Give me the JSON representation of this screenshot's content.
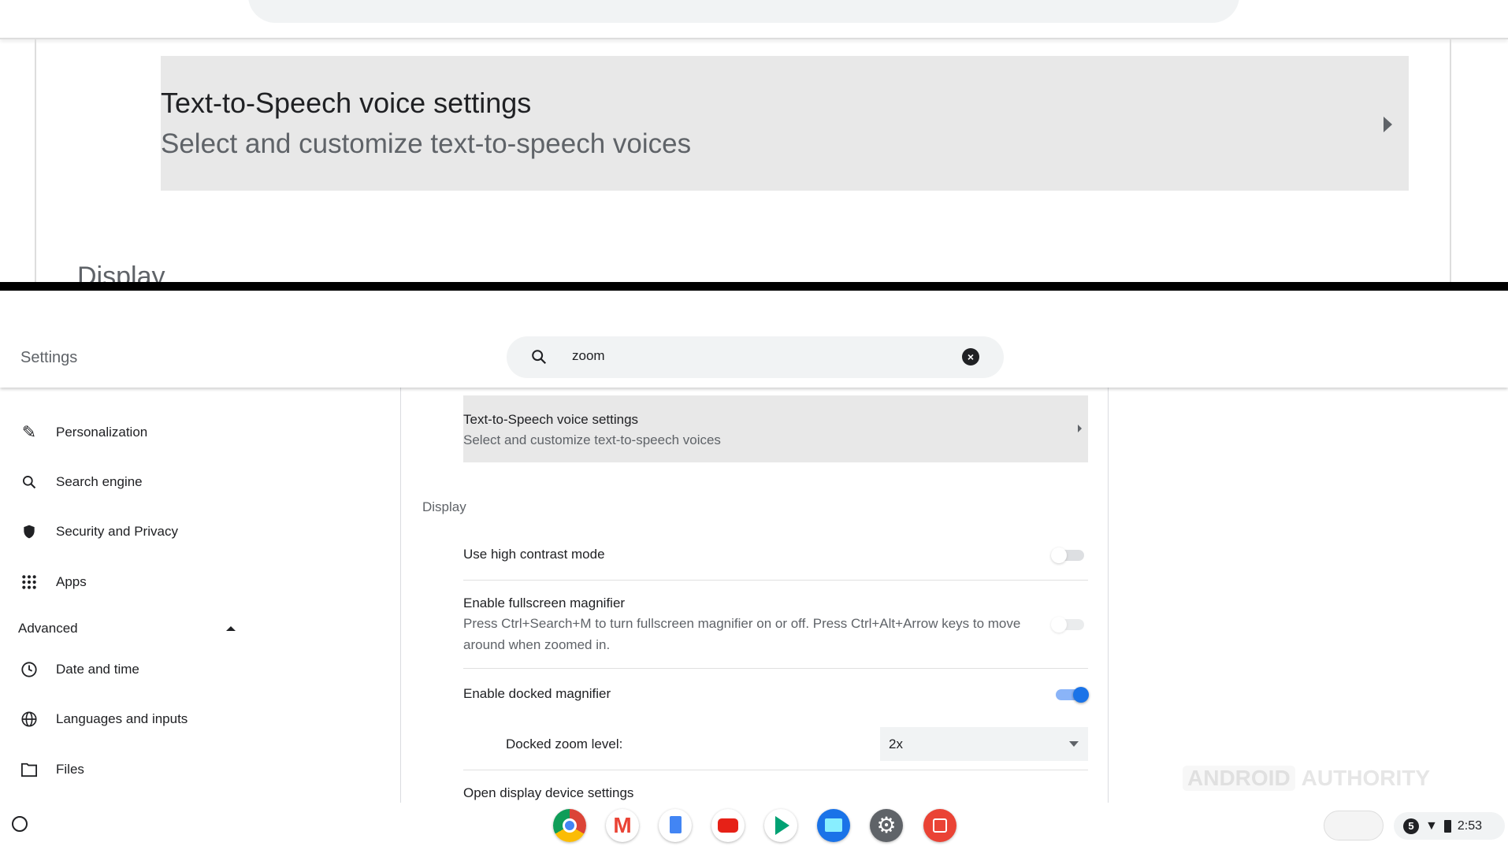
{
  "magnifier": {
    "card_title": "Text-to-Speech voice settings",
    "card_subtitle": "Select and customize text-to-speech voices",
    "section": "Display"
  },
  "window": {
    "title": "Settings",
    "controls": [
      "zoom-icon",
      "minimize-icon",
      "restore-icon",
      "close-icon"
    ]
  },
  "search": {
    "value": "zoom"
  },
  "sidebar": {
    "items": [
      {
        "label": "Personalization",
        "icon": "pencil-icon"
      },
      {
        "label": "Search engine",
        "icon": "search-icon"
      },
      {
        "label": "Security and Privacy",
        "icon": "shield-icon"
      },
      {
        "label": "Apps",
        "icon": "apps-grid-icon"
      }
    ],
    "advanced": "Advanced",
    "advanced_items": [
      {
        "label": "Date and time",
        "icon": "clock-icon"
      },
      {
        "label": "Languages and inputs",
        "icon": "globe-icon"
      },
      {
        "label": "Files",
        "icon": "folder-icon"
      }
    ]
  },
  "main": {
    "tts": {
      "title": "Text-to-Speech voice settings",
      "subtitle": "Select and customize text-to-speech voices"
    },
    "section": "Display",
    "high_contrast": {
      "label": "Use high contrast mode",
      "on": false
    },
    "fullscreen": {
      "label": "Enable fullscreen magnifier",
      "desc": "Press Ctrl+Search+M to turn fullscreen magnifier on or off. Press Ctrl+Alt+Arrow keys to move around when zoomed in.",
      "on": false
    },
    "docked": {
      "label": "Enable docked magnifier",
      "on": true
    },
    "docked_zoom": {
      "label": "Docked zoom level:",
      "value": "2x"
    },
    "open_display": "Open display device settings"
  },
  "shelf": {
    "apps": [
      "chrome",
      "gmail",
      "docs",
      "youtube",
      "play-store",
      "files",
      "settings",
      "screencast"
    ]
  },
  "watermark": {
    "a": "ANDROID",
    "b": "AUTHORITY"
  },
  "tray": {
    "notifications": "5",
    "time": "2:53"
  },
  "colors": {
    "accent": "#1a73e8",
    "card": "#e8e8e8"
  }
}
